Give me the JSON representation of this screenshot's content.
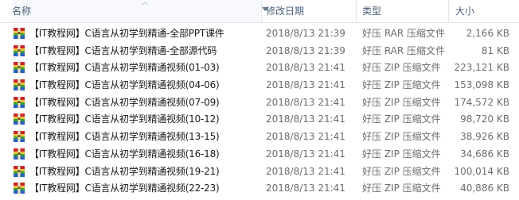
{
  "columns": {
    "name": "名称",
    "date": "修改日期",
    "type": "类型",
    "size": "大小"
  },
  "files": [
    {
      "name": "【IT教程网】C语言从初学到精通-全部PPT课件",
      "date": "2018/8/13 21:39",
      "type": "好压 RAR 压缩文件",
      "size": "2,166 KB"
    },
    {
      "name": "【IT教程网】C语言从初学到精通-全部源代码",
      "date": "2018/8/13 21:39",
      "type": "好压 RAR 压缩文件",
      "size": "81 KB"
    },
    {
      "name": "【IT教程网】C语言从初学到精通视频(01-03)",
      "date": "2018/8/13 21:41",
      "type": "好压 ZIP 压缩文件",
      "size": "223,121 KB"
    },
    {
      "name": "【IT教程网】C语言从初学到精通视频(04-06)",
      "date": "2018/8/13 21:41",
      "type": "好压 ZIP 压缩文件",
      "size": "153,098 KB"
    },
    {
      "name": "【IT教程网】C语言从初学到精通视频(07-09)",
      "date": "2018/8/13 21:41",
      "type": "好压 ZIP 压缩文件",
      "size": "174,572 KB"
    },
    {
      "name": "【IT教程网】C语言从初学到精通视频(10-12)",
      "date": "2018/8/13 21:41",
      "type": "好压 ZIP 压缩文件",
      "size": "98,720 KB"
    },
    {
      "name": "【IT教程网】C语言从初学到精通视频(13-15)",
      "date": "2018/8/13 21:41",
      "type": "好压 ZIP 压缩文件",
      "size": "38,926 KB"
    },
    {
      "name": "【IT教程网】C语言从初学到精通视频(16-18)",
      "date": "2018/8/13 21:41",
      "type": "好压 ZIP 压缩文件",
      "size": "34,686 KB"
    },
    {
      "name": "【IT教程网】C语言从初学到精通视频(19-21)",
      "date": "2018/8/13 21:41",
      "type": "好压 ZIP 压缩文件",
      "size": "100,014 KB"
    },
    {
      "name": "【IT教程网】C语言从初学到精通视频(22-23)",
      "date": "2018/8/13 21:41",
      "type": "好压 ZIP 压缩文件",
      "size": "40,886 KB"
    }
  ],
  "icons": {
    "sort": "sort-ascending-icon",
    "dropdown": "chevron-down-icon",
    "file": "archive-file-icon"
  },
  "colors": {
    "header_text": "#4c607a",
    "archive_red": "#c8262b",
    "archive_blue": "#2a5fc0",
    "archive_green": "#3a9b3a",
    "archive_yellow": "#e8c23a"
  }
}
